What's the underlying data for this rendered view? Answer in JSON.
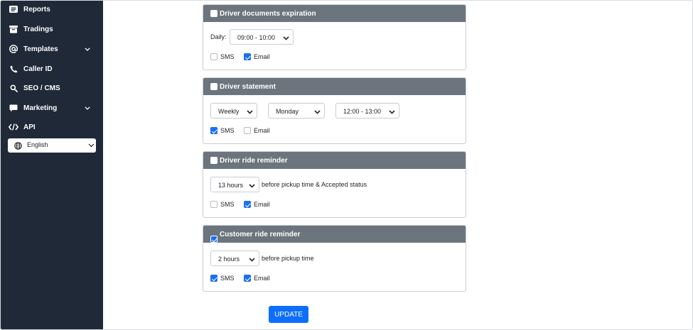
{
  "sidebar": {
    "items": [
      {
        "label": "Reports",
        "icon": "reports-icon"
      },
      {
        "label": "Tradings",
        "icon": "tradings-icon"
      },
      {
        "label": "Templates",
        "icon": "at-icon",
        "has_submenu": true
      },
      {
        "label": "Caller ID",
        "icon": "phone-icon"
      },
      {
        "label": "SEO / CMS",
        "icon": "search-icon"
      },
      {
        "label": "Marketing",
        "icon": "chat-icon",
        "has_submenu": true
      },
      {
        "label": "API",
        "icon": "code-icon"
      }
    ],
    "language": {
      "label": "English"
    }
  },
  "cards": [
    {
      "title": "Driver documents expiration",
      "enabled": false,
      "schedule_label": "Daily:",
      "time_value": "09:00 - 10:00",
      "sms": false,
      "email": true
    },
    {
      "title": "Driver statement",
      "enabled": false,
      "frequency_value": "Weekly",
      "day_value": "Monday",
      "time_value": "12:00 - 13:00",
      "sms": true,
      "email": false
    },
    {
      "title": "Driver ride reminder",
      "enabled": false,
      "hours_value": "13 hours",
      "suffix_text": "before pickup time & Accepted status",
      "sms": false,
      "email": true
    },
    {
      "title": "Customer ride reminder",
      "enabled": true,
      "hours_value": "2 hours",
      "suffix_text": "before pickup time",
      "sms": true,
      "email": true
    }
  ],
  "labels": {
    "sms": "SMS",
    "email": "Email"
  },
  "update_button": {
    "label": "UPDATE"
  },
  "colors": {
    "sidebar_bg": "#1f2937",
    "card_header_bg": "#6c757d",
    "accent": "#0d6efd",
    "checkbox_checked": "#1d6ff2"
  }
}
